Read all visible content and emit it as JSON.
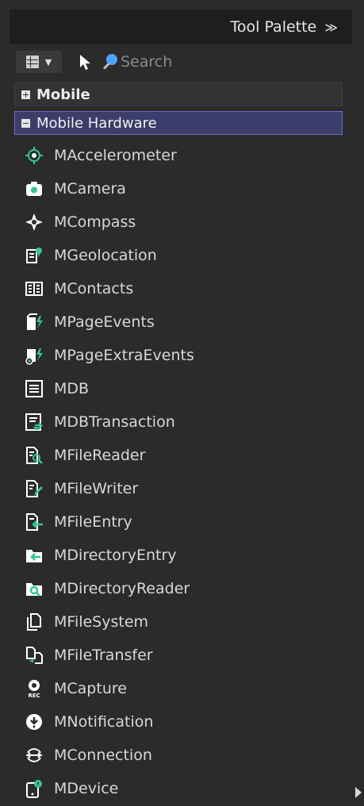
{
  "header": {
    "title": "Tool Palette",
    "collapse_glyph": "≫"
  },
  "toolbar": {
    "search_placeholder": "Search",
    "view_icon": "grid-view-icon",
    "pointer_icon": "pointer-icon",
    "search_icon": "search-icon"
  },
  "categories": [
    {
      "label": "Mobile",
      "state": "collapsed"
    },
    {
      "label": "Mobile Hardware",
      "state": "expanded"
    }
  ],
  "items": [
    {
      "label": "MAccelerometer",
      "icon": "accelerometer-icon"
    },
    {
      "label": "MCamera",
      "icon": "camera-icon"
    },
    {
      "label": "MCompass",
      "icon": "compass-icon"
    },
    {
      "label": "MGeolocation",
      "icon": "geolocation-icon"
    },
    {
      "label": "MContacts",
      "icon": "contacts-icon"
    },
    {
      "label": "MPageEvents",
      "icon": "page-events-icon"
    },
    {
      "label": "MPageExtraEvents",
      "icon": "page-extra-events-icon"
    },
    {
      "label": "MDB",
      "icon": "database-icon"
    },
    {
      "label": "MDBTransaction",
      "icon": "db-transaction-icon"
    },
    {
      "label": "MFileReader",
      "icon": "file-reader-icon"
    },
    {
      "label": "MFileWriter",
      "icon": "file-writer-icon"
    },
    {
      "label": "MFileEntry",
      "icon": "file-entry-icon"
    },
    {
      "label": "MDirectoryEntry",
      "icon": "directory-entry-icon"
    },
    {
      "label": "MDirectoryReader",
      "icon": "directory-reader-icon"
    },
    {
      "label": "MFileSystem",
      "icon": "file-system-icon"
    },
    {
      "label": "MFileTransfer",
      "icon": "file-transfer-icon"
    },
    {
      "label": "MCapture",
      "icon": "capture-icon"
    },
    {
      "label": "MNotification",
      "icon": "notification-icon"
    },
    {
      "label": "MConnection",
      "icon": "connection-icon"
    },
    {
      "label": "MDevice",
      "icon": "device-icon"
    }
  ],
  "colors": {
    "panel_bg": "#2b2b2b",
    "header_bg": "#1e1e1e",
    "selected_bg": "#3d3d6b",
    "selected_border": "#6c6cc8",
    "icon_accent": "#35c49a"
  }
}
